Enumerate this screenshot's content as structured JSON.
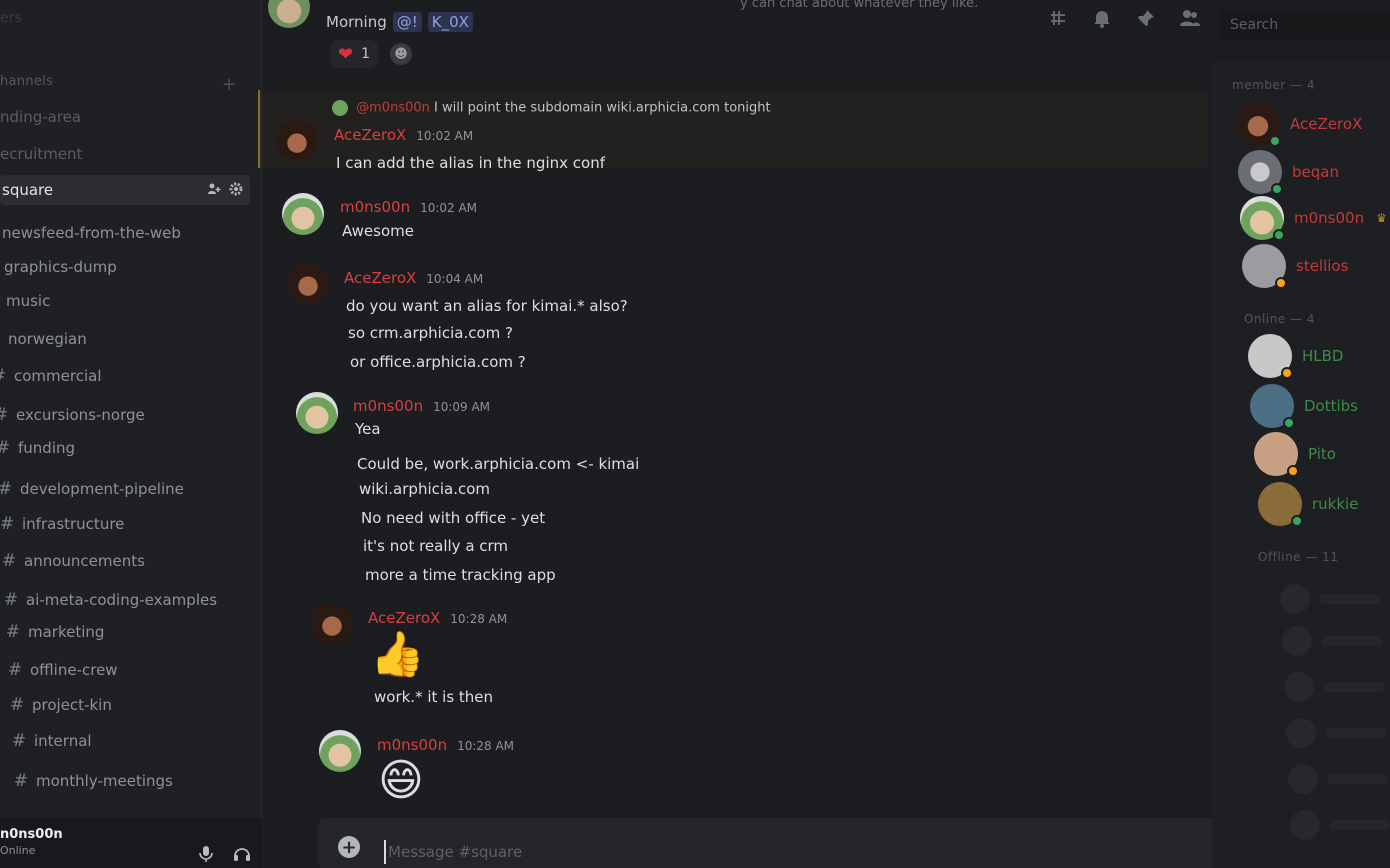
{
  "sidebar": {
    "server_top": "ers",
    "category": "hannels",
    "channels": [
      {
        "label": "nding-area"
      },
      {
        "label": "ecruitment"
      },
      {
        "label": "square"
      },
      {
        "label": "newsfeed-from-the-web"
      },
      {
        "label": "graphics-dump"
      },
      {
        "label": "music"
      },
      {
        "label": "norwegian"
      },
      {
        "label": "commercial"
      },
      {
        "label": "excursions-norge"
      },
      {
        "label": "funding"
      },
      {
        "label": "development-pipeline"
      },
      {
        "label": "infrastructure"
      },
      {
        "label": "announcements"
      },
      {
        "label": "ai-meta-coding-examples"
      },
      {
        "label": "marketing"
      },
      {
        "label": "offline-crew"
      },
      {
        "label": "project-kin"
      },
      {
        "label": "internal"
      },
      {
        "label": "monthly-meetings"
      }
    ],
    "active_channel": "square"
  },
  "user": {
    "name": "n0ns00n",
    "status": "Online"
  },
  "header": {
    "topic_fragment": "y can chat about whatever they like.",
    "search_placeholder": "Search"
  },
  "chat": {
    "pinned_top": {
      "text": "Morning",
      "mention1": "@!",
      "mention2": "K_0X",
      "reaction_count": "1"
    },
    "reply": {
      "author": "@m0ns00n",
      "text": "I will point the subdomain wiki.arphicia.com tonight"
    },
    "messages": [
      {
        "author": "AceZeroX",
        "time": "10:02 AM",
        "lines": [
          "I can add the alias in the nginx conf"
        ]
      },
      {
        "author": "m0ns00n",
        "time": "10:02 AM",
        "lines": [
          "Awesome"
        ]
      },
      {
        "author": "AceZeroX",
        "time": "10:04 AM",
        "lines": [
          "do you want an alias for kimai.* also?",
          "so crm.arphicia.com ?",
          "or office.arphicia.com ?"
        ]
      },
      {
        "author": "m0ns00n",
        "time": "10:09 AM",
        "lines": [
          "Yea",
          "Could be, work.arphicia.com <- kimai",
          "wiki.arphicia.com",
          "No need with office - yet",
          "it's not really a crm",
          "more a time tracking app"
        ]
      },
      {
        "author": "AceZeroX",
        "time": "10:28 AM",
        "emoji": "👍",
        "lines": [
          "work.* it is then"
        ]
      },
      {
        "author": "m0ns00n",
        "time": "10:28 AM",
        "emoji": "😄",
        "lines": []
      }
    ],
    "composer_placeholder": "Message #square"
  },
  "members": {
    "group1_label": "member — 4",
    "group1": [
      {
        "name": "AceZeroX",
        "status_color": "#3ba55d"
      },
      {
        "name": "beqan",
        "status_color": "#3ba55d"
      },
      {
        "name": "m0ns00n",
        "status_color": "#3ba55d"
      },
      {
        "name": "stellios",
        "status_color": "#faa61a"
      }
    ],
    "group2_label": "Online — 4",
    "group2": [
      {
        "name": "HLBD",
        "status_color": "#faa61a"
      },
      {
        "name": "Dottibs",
        "status_color": "#3ba55d"
      },
      {
        "name": "Pito",
        "status_color": "#faa61a"
      },
      {
        "name": "rukkie",
        "status_color": "#3ba55d"
      }
    ],
    "group3_label": "Offline — 11"
  },
  "colors": {
    "accent_red": "#d64040",
    "mention_bg": "#2e3350",
    "online": "#3ba55d",
    "idle": "#faa61a"
  }
}
